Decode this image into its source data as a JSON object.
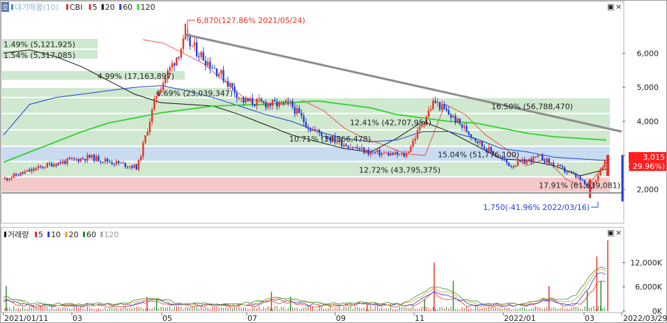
{
  "colors": {
    "up": "#e8322b",
    "down": "#1f3fd6",
    "ma5": "#e8322b",
    "ma20": "#111111",
    "ma60": "#1f3fd6",
    "ma120": "#2ed12e",
    "trendline": "#8c8c8c",
    "band_green": "#cfe8cf",
    "band_blue": "#c9dcef",
    "band_pink": "#f3c9c9",
    "price_tag_bg": "#ff2020",
    "price_tag_text": "#ffffff",
    "vol5": "#e8322b",
    "vol10": "#1f3fd6",
    "vol20": "#e0a020",
    "vol60": "#2f8f2f",
    "vol120": "#a0a0a0"
  },
  "price_panel": {
    "corner_label": "호",
    "legend": [
      {
        "label": "대기매물(10)",
        "color": "#3c8fd0",
        "muted": true
      },
      {
        "label": "CBI",
        "color": "#e8322b"
      },
      {
        "label": "5",
        "color": "#e8322b"
      },
      {
        "label": "20",
        "color": "#111111"
      },
      {
        "label": "60",
        "color": "#1f3fd6"
      },
      {
        "label": "120",
        "color": "#2ed12e"
      }
    ],
    "window_buttons": [
      "▣",
      "×"
    ],
    "current_price": "3,015",
    "current_change": "( 29.96%)",
    "high_annotation": "6,870(127.86% 2021/05/24)",
    "low_annotation": "1,750(-41.96% 2022/03/16)"
  },
  "volume_panel": {
    "legend": [
      {
        "label": "거래량",
        "color": "#111111"
      },
      {
        "label": "5",
        "color": "#e8322b"
      },
      {
        "label": "10",
        "color": "#1f3fd6"
      },
      {
        "label": "20",
        "color": "#e0a020"
      },
      {
        "label": "60",
        "color": "#2f8f2f"
      },
      {
        "label": "120",
        "color": "#a0a0a0"
      }
    ],
    "window_buttons": [
      "▣",
      "×"
    ]
  },
  "chart_data": [
    {
      "type": "candlestick",
      "title": "",
      "ylim": [
        1050,
        7400
      ],
      "y_ticks": [
        {
          "value": 2000,
          "label": "2,000"
        },
        {
          "value": 3000,
          "label": "3,000"
        },
        {
          "value": 4000,
          "label": "4,000"
        },
        {
          "value": 5000,
          "label": "5,000"
        },
        {
          "value": 6000,
          "label": "6,000"
        }
      ],
      "x_tick_labels": [
        "2021/01/11",
        "03",
        "05",
        "07",
        "09",
        "11",
        "2022/01",
        "03",
        "2022/03/29"
      ],
      "date_range": [
        "2021/01/11",
        "2022/03/29"
      ],
      "key_points": [
        {
          "date": "2021/01/11",
          "close": 2300
        },
        {
          "date": "2021/02/15",
          "close": 2750
        },
        {
          "date": "2021/03/15",
          "close": 2950
        },
        {
          "date": "2021/04/19",
          "close": 2650
        },
        {
          "date": "2021/05/03",
          "close": 4800
        },
        {
          "date": "2021/05/24",
          "high": 6870,
          "close": 6400
        },
        {
          "date": "2021/06/21",
          "close": 5300
        },
        {
          "date": "2021/07/05",
          "close": 4600
        },
        {
          "date": "2021/07/26",
          "close": 4500
        },
        {
          "date": "2021/08/09",
          "close": 4500
        },
        {
          "date": "2021/08/23",
          "close": 3800
        },
        {
          "date": "2021/09/13",
          "close": 3400
        },
        {
          "date": "2021/10/04",
          "close": 3100
        },
        {
          "date": "2021/11/01",
          "close": 3000
        },
        {
          "date": "2021/11/22",
          "close": 4600
        },
        {
          "date": "2021/12/06",
          "close": 4100
        },
        {
          "date": "2021/12/27",
          "close": 3300
        },
        {
          "date": "2022/01/17",
          "close": 2700
        },
        {
          "date": "2022/02/07",
          "close": 2950
        },
        {
          "date": "2022/03/07",
          "close": 2350
        },
        {
          "date": "2022/03/16",
          "low": 1750,
          "close": 2000
        },
        {
          "date": "2022/03/29",
          "close": 3015
        }
      ],
      "volume_profile_bands": [
        {
          "label": "1.49% (5,121,925)",
          "from": 6100,
          "to": 6420,
          "color": "green"
        },
        {
          "label": "1.54% (5,317,085)",
          "from": 5800,
          "to": 6100,
          "color": "green"
        },
        {
          "label": "4.99% (17,163,897)",
          "from": 5180,
          "to": 5480,
          "color": "green"
        },
        {
          "label": "6.69% (23,039,347)",
          "from": 4680,
          "to": 4980,
          "color": "green"
        },
        {
          "label": "16.50% (56,788,470)",
          "from": 4210,
          "to": 4680,
          "color": "green"
        },
        {
          "label": "12.41% (42,707,954)",
          "from": 3730,
          "to": 4210,
          "color": "green"
        },
        {
          "label": "10.71% (36,866,478)",
          "from": 3250,
          "to": 3730,
          "color": "green"
        },
        {
          "label": "15.04% (51,776,100)",
          "from": 2800,
          "to": 3250,
          "color": "blue"
        },
        {
          "label": "12.72% (43,795,375)",
          "from": 2350,
          "to": 2800,
          "color": "green"
        },
        {
          "label": "17.91% (61,639,081)",
          "from": 1900,
          "to": 2350,
          "color": "pink"
        }
      ],
      "support_line": 1900,
      "trendline": [
        {
          "date": "2021/05/24",
          "value": 6550
        },
        {
          "date": "2022/03/29",
          "value": 3700
        }
      ],
      "series": [
        {
          "name": "5",
          "values": [
            6400,
            6300,
            6000,
            5700,
            5200,
            4700,
            4550,
            4500,
            4600,
            4300,
            3800,
            3500,
            3300,
            3050,
            3000,
            4500,
            4200,
            3600,
            3200,
            2700,
            2900,
            2300,
            2050,
            2800
          ]
        },
        {
          "name": "20",
          "values": [
            6000,
            6100,
            5900,
            5600,
            5200,
            4800,
            4550,
            4500,
            4450,
            4200,
            3900,
            3600,
            3400,
            3200,
            3100,
            3500,
            4000,
            3700,
            3300,
            2900,
            2850,
            2700,
            2400,
            2600
          ]
        },
        {
          "name": "60",
          "values": [
            3600,
            4500,
            4700,
            4800,
            4900,
            5000,
            5050,
            4900,
            4700,
            4450,
            4200,
            4000,
            3700,
            3500,
            3400,
            3450,
            3700,
            3700,
            3500,
            3200,
            3100,
            2950,
            2900,
            2850
          ]
        },
        {
          "name": "120",
          "values": [
            2800,
            3100,
            3400,
            3700,
            3950,
            4100,
            4250,
            4350,
            4450,
            4480,
            4500,
            4550,
            4600,
            4500,
            4400,
            4200,
            4100,
            4000,
            3950,
            3800,
            3650,
            3550,
            3500,
            3450
          ]
        }
      ]
    },
    {
      "type": "bar",
      "title": "",
      "ylim": [
        0,
        20000
      ],
      "y_ticks": [
        {
          "value": 0,
          "label": "0K"
        },
        {
          "value": 6000,
          "label": "6,000K"
        },
        {
          "value": 12000,
          "label": "12,000K"
        }
      ],
      "spikes": [
        {
          "date": "2021/01/13",
          "value": 6200
        },
        {
          "date": "2021/04/26",
          "value": 3500
        },
        {
          "date": "2021/05/03",
          "value": 3200
        },
        {
          "date": "2021/07/26",
          "value": 4800
        },
        {
          "date": "2021/08/09",
          "value": 3600
        },
        {
          "date": "2021/10/04",
          "value": 1500
        },
        {
          "date": "2021/11/15",
          "value": 3000
        },
        {
          "date": "2021/11/22",
          "value": 12000
        },
        {
          "date": "2021/12/06",
          "value": 7500
        },
        {
          "date": "2022/02/14",
          "value": 6200
        },
        {
          "date": "2022/03/14",
          "value": 5000
        },
        {
          "date": "2022/03/21",
          "value": 13500
        },
        {
          "date": "2022/03/24",
          "value": 7500
        },
        {
          "date": "2022/03/29",
          "value": 17500
        }
      ]
    }
  ]
}
